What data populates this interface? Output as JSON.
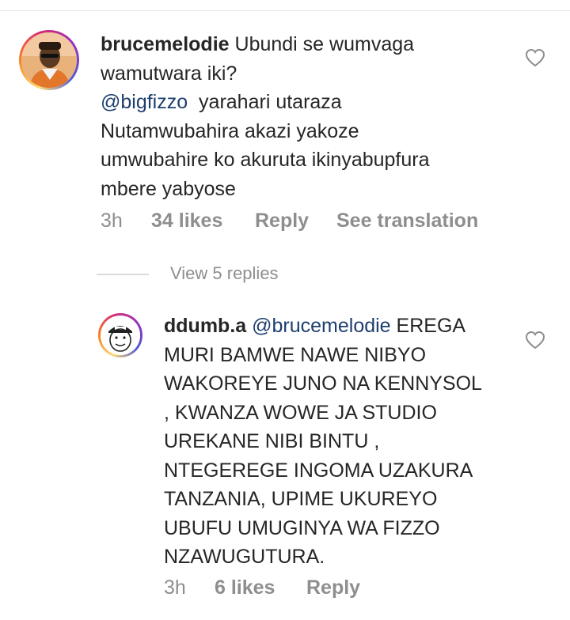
{
  "comment1": {
    "username": "brucemelodie",
    "line1": "Ubundi se wumvaga",
    "line2": "wamutwara iki?",
    "mention": "@bigfizzo",
    "line3_rest": "  yarahari utaraza",
    "line4": "Nutamwubahira akazi yakoze",
    "line5": "umwubahire ko akuruta ikinyabupfura",
    "line6": "mbere yabyose",
    "time": "3h",
    "likes": "34 likes",
    "reply": "Reply",
    "translate": "See translation",
    "avatar_icon": "profile-photo"
  },
  "view_replies": "View 5 replies",
  "comment2": {
    "username": "ddumb.a",
    "mention": "@brucemelodie",
    "line1_rest": " EREGA",
    "line2": "MURI BAMWE NAWE NIBYO",
    "line3": "WAKOREYE JUNO NA KENNYSOL",
    "line4": ", KWANZA WOWE JA STUDIO",
    "line5": "UREKANE NIBI BINTU ,",
    "line6": "NTEGEREGE INGOMA UZAKURA",
    "line7": "TANZANIA, UPIME UKUREYO",
    "line8": "UBUFU UMUGINYA WA FIZZO",
    "line9": "NZAWUGUTURA.",
    "time": "3h",
    "likes": "6 likes",
    "reply": "Reply",
    "avatar_icon": "cartoon-face-avatar"
  },
  "colors": {
    "text": "#262626",
    "muted": "#8e8e8e",
    "mention": "#1e3f6e",
    "divider": "#dbdbdb"
  }
}
